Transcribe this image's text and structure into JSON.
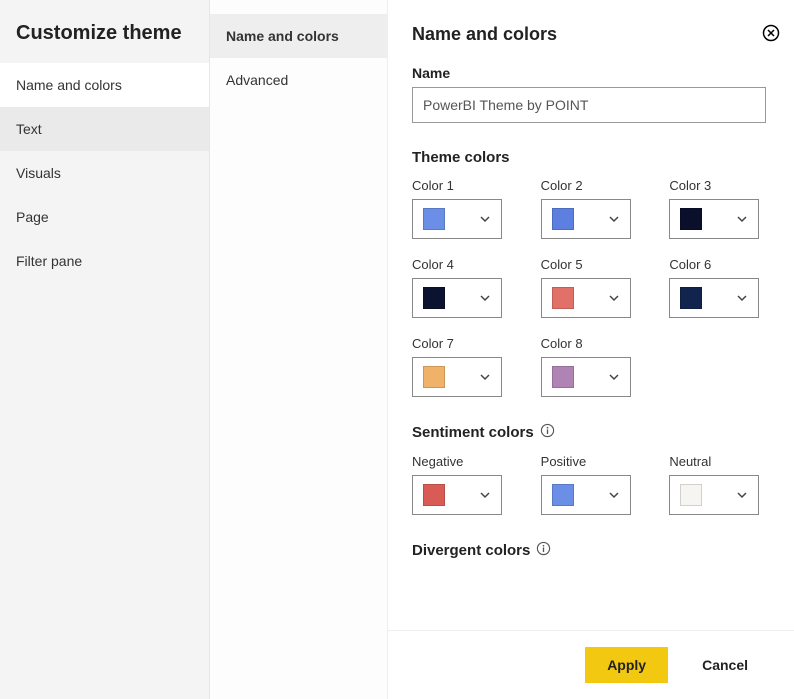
{
  "dialog_title": "Customize theme",
  "left_nav": {
    "items": [
      {
        "label": "Name and colors",
        "state": "active"
      },
      {
        "label": "Text",
        "state": "hovered"
      },
      {
        "label": "Visuals",
        "state": "normal"
      },
      {
        "label": "Page",
        "state": "normal"
      },
      {
        "label": "Filter pane",
        "state": "normal"
      }
    ]
  },
  "mid_nav": {
    "items": [
      {
        "label": "Name and colors",
        "state": "active"
      },
      {
        "label": "Advanced",
        "state": "normal"
      }
    ]
  },
  "panel": {
    "title": "Name and colors",
    "name_label": "Name",
    "name_value": "PowerBI Theme by POINT",
    "theme_section": "Theme colors",
    "theme_colors": [
      {
        "label": "Color 1",
        "hex": "#6b8fe6"
      },
      {
        "label": "Color 2",
        "hex": "#5c7fe0"
      },
      {
        "label": "Color 3",
        "hex": "#0a0f2b"
      },
      {
        "label": "Color 4",
        "hex": "#0b1330"
      },
      {
        "label": "Color 5",
        "hex": "#e07068"
      },
      {
        "label": "Color 6",
        "hex": "#10244d"
      },
      {
        "label": "Color 7",
        "hex": "#f0b168"
      },
      {
        "label": "Color 8",
        "hex": "#b083b5"
      }
    ],
    "sentiment_section": "Sentiment colors",
    "sentiment_colors": [
      {
        "label": "Negative",
        "hex": "#d85c55"
      },
      {
        "label": "Positive",
        "hex": "#6b8fe6"
      },
      {
        "label": "Neutral",
        "hex": "#f7f5f2"
      }
    ],
    "divergent_section": "Divergent colors"
  },
  "footer": {
    "apply": "Apply",
    "cancel": "Cancel"
  }
}
